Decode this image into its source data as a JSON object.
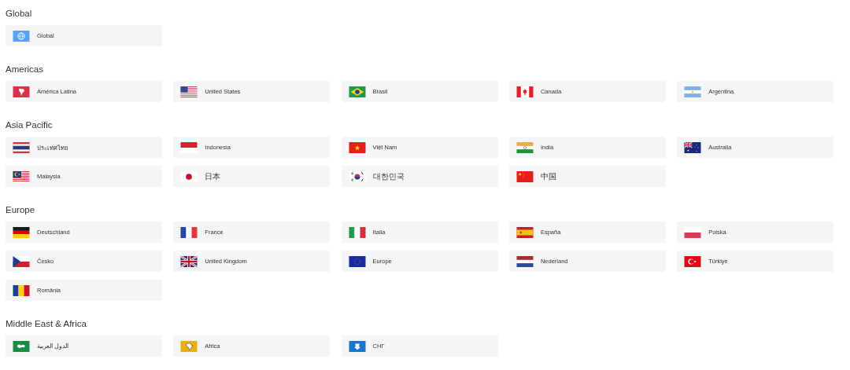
{
  "sections": [
    {
      "title": "Global",
      "items": [
        {
          "label": "Global"
        }
      ]
    },
    {
      "title": "Americas",
      "items": [
        {
          "label": "América Latina"
        },
        {
          "label": "United States"
        },
        {
          "label": "Brasil"
        },
        {
          "label": "Canada"
        },
        {
          "label": "Argentina"
        }
      ]
    },
    {
      "title": "Asia Pacific",
      "items": [
        {
          "label": "ประเทศไทย"
        },
        {
          "label": "Indonesia"
        },
        {
          "label": "Việt Nam"
        },
        {
          "label": "India"
        },
        {
          "label": "Australia"
        },
        {
          "label": "Malaysia"
        },
        {
          "label": "日本"
        },
        {
          "label": "대한민국"
        },
        {
          "label": "中国"
        }
      ]
    },
    {
      "title": "Europe",
      "items": [
        {
          "label": "Deutschland"
        },
        {
          "label": "France"
        },
        {
          "label": "Italia"
        },
        {
          "label": "España"
        },
        {
          "label": "Polska"
        },
        {
          "label": "Česko"
        },
        {
          "label": "United Kingdom"
        },
        {
          "label": "Europe"
        },
        {
          "label": "Nederland"
        },
        {
          "label": "Türkiye"
        },
        {
          "label": "România"
        }
      ]
    },
    {
      "title": "Middle East & Africa",
      "items": [
        {
          "label": "الدول العربية"
        },
        {
          "label": "Africa"
        },
        {
          "label": "СНГ"
        }
      ]
    }
  ]
}
